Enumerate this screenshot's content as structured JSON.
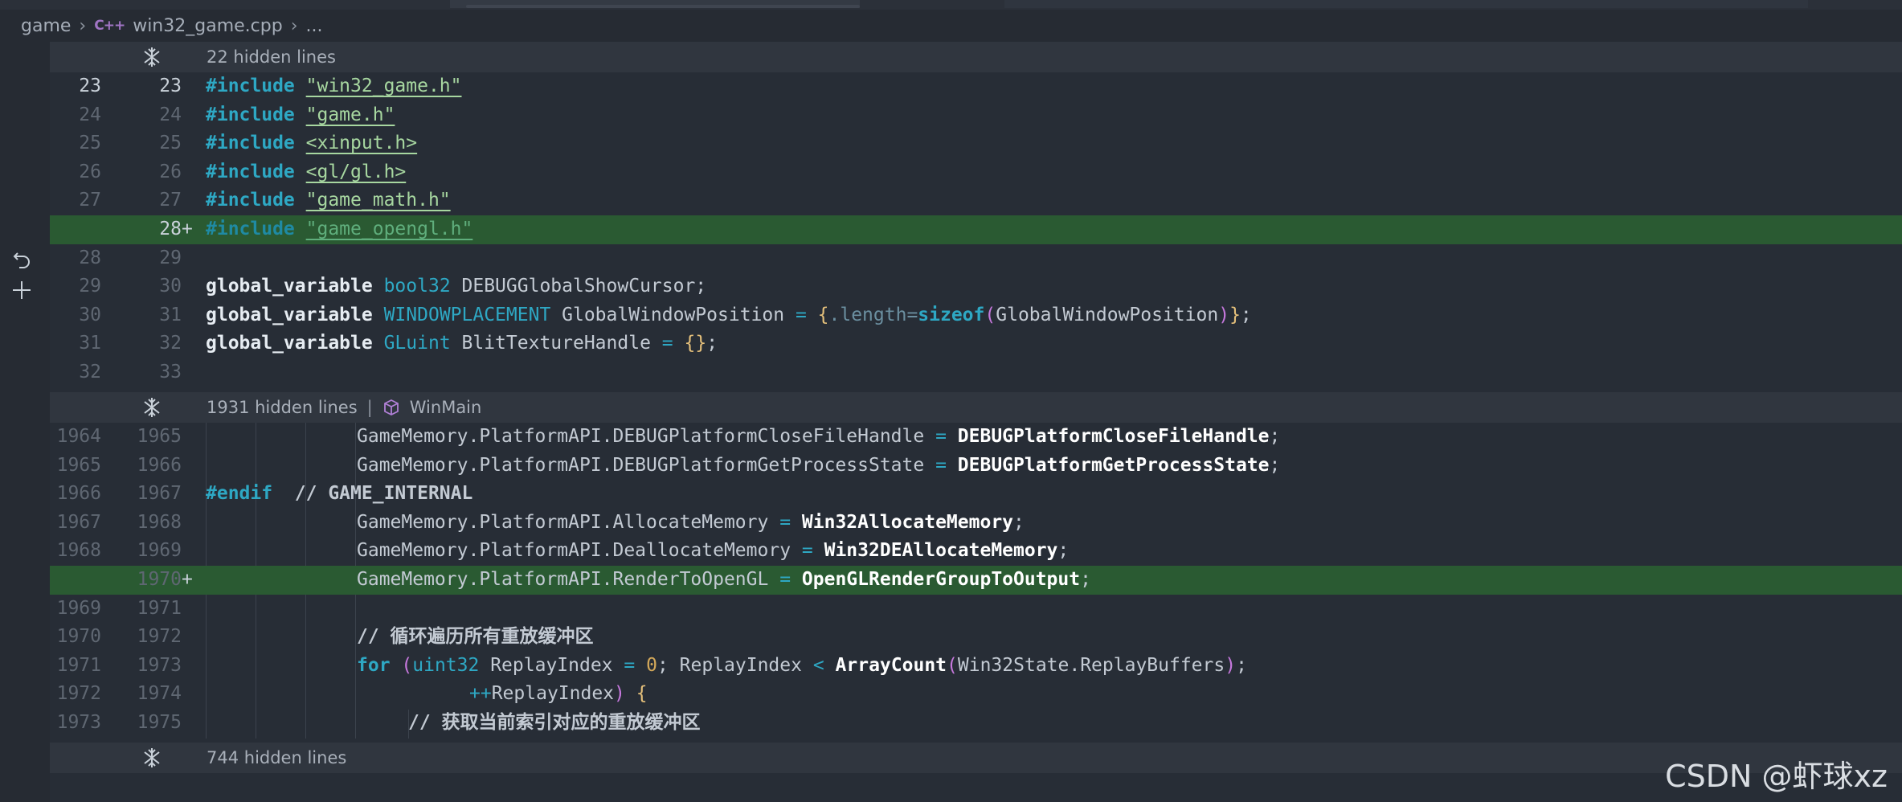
{
  "breadcrumb": {
    "folder": "game",
    "lang_badge": "C++",
    "file": "win32_game.cpp",
    "more": "..."
  },
  "hidden_blocks": [
    {
      "label": "22 hidden lines"
    },
    {
      "label": "1931 hidden lines",
      "symbol": "WinMain"
    },
    {
      "label": "744 hidden lines"
    }
  ],
  "lines_a": [
    {
      "old": "23",
      "new": "23",
      "current": true
    },
    {
      "old": "24",
      "new": "24"
    },
    {
      "old": "25",
      "new": "25"
    },
    {
      "old": "26",
      "new": "26"
    },
    {
      "old": "27",
      "new": "27"
    },
    {
      "old": "",
      "new": "28",
      "added": true,
      "marker": "+"
    },
    {
      "old": "28",
      "new": "29"
    },
    {
      "old": "29",
      "new": "30"
    },
    {
      "old": "30",
      "new": "31"
    },
    {
      "old": "31",
      "new": "32"
    },
    {
      "old": "32",
      "new": "33"
    }
  ],
  "lines_b": [
    {
      "old": "1964",
      "new": "1965"
    },
    {
      "old": "1965",
      "new": "1966"
    },
    {
      "old": "1966",
      "new": "1967"
    },
    {
      "old": "1967",
      "new": "1968"
    },
    {
      "old": "1968",
      "new": "1969"
    },
    {
      "old": "",
      "new": "1970",
      "added": true,
      "marker": "+"
    },
    {
      "old": "1969",
      "new": "1971"
    },
    {
      "old": "1970",
      "new": "1972"
    },
    {
      "old": "1971",
      "new": "1973"
    },
    {
      "old": "1972",
      "new": "1974"
    },
    {
      "old": "1973",
      "new": "1975"
    }
  ],
  "code": {
    "include": "#include",
    "inc1": "\"win32_game.h\"",
    "inc2": "\"game.h\"",
    "inc3": "<xinput.h>",
    "inc4": "<gl/gl.h>",
    "inc5": "\"game_math.h\"",
    "inc6": "\"game_opengl.h\"",
    "gv": "global_variable",
    "l30_type": "bool32",
    "l30_rest": " DEBUGGlobalShowCursor;",
    "l31_type": "WINDOWPLACEMENT",
    "l31_a": " GlobalWindowPosition ",
    "l31_eq": "=",
    "l31_b": ".length=",
    "l31_sizeof": "sizeof",
    "l31_arg": "GlobalWindowPosition",
    "l32_type": "GLuint",
    "l32_a": " BlitTextureHandle ",
    "l32_eq": "=",
    "l32_br": "{}",
    "b1_a": "GameMemory.PlatformAPI.DEBUGPlatformCloseFileHandle ",
    "b1_fn": "DEBUGPlatformCloseFileHandle",
    "b2_a": "GameMemory.PlatformAPI.DEBUGPlatformGetProcessState ",
    "b2_fn": "DEBUGPlatformGetProcessState",
    "endif": "#endif",
    "endif_cmt": "// GAME_INTERNAL",
    "b4_a": "GameMemory.PlatformAPI.AllocateMemory ",
    "b4_fn": "Win32AllocateMemory",
    "b5_a": "GameMemory.PlatformAPI.DeallocateMemory ",
    "b5_fn": "Win32DEAllocateMemory",
    "b6_a": "GameMemory.PlatformAPI.RenderToOpenGL ",
    "b6_fn": "OpenGLRenderGroupToOutput",
    "cmt1": "// 循环遍历所有重放缓冲区",
    "for_kw": "for",
    "for_type": "uint32",
    "for_a": " ReplayIndex ",
    "for_zero": "0",
    "for_b": "; ReplayIndex ",
    "for_fn": "ArrayCount",
    "for_arg": "Win32State.ReplayBuffers",
    "inc_op": "++",
    "inc_var": "ReplayIndex",
    "cmt2": "// 获取当前索引对应的重放缓冲区"
  },
  "watermark": "CSDN @虾球xz",
  "colors": {
    "added_line": "#2a5a32",
    "keyword": "#2ea8c4",
    "string": "#a7d7a0",
    "background": "#272d36"
  }
}
